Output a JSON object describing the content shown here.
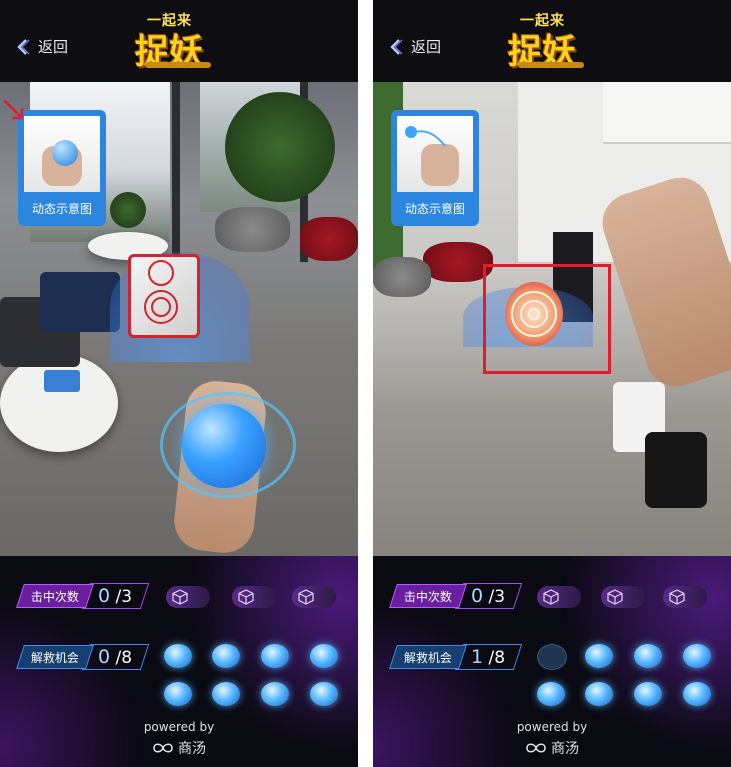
{
  "left": {
    "back_label": "返回",
    "logo_top": "一起来",
    "logo_main": "捉妖",
    "hint_label": "动态示意图",
    "hit": {
      "label": "击中次数",
      "value": "0",
      "total": "/3"
    },
    "chance": {
      "label": "解救机会",
      "value": "0",
      "total": "/8"
    }
  },
  "right": {
    "back_label": "返回",
    "logo_top": "一起来",
    "logo_main": "捉妖",
    "hint_label": "动态示意图",
    "hit": {
      "label": "击中次数",
      "value": "0",
      "total": "/3"
    },
    "chance": {
      "label": "解救机会",
      "value": "1",
      "total": "/8"
    }
  },
  "footer": {
    "powered": "powered by",
    "brand": "商汤"
  },
  "colors": {
    "accent_purple": "#6a1fa0",
    "accent_blue": "#173e70",
    "target_red": "#e11d2d",
    "orb_blue": "#3aa2ff"
  }
}
